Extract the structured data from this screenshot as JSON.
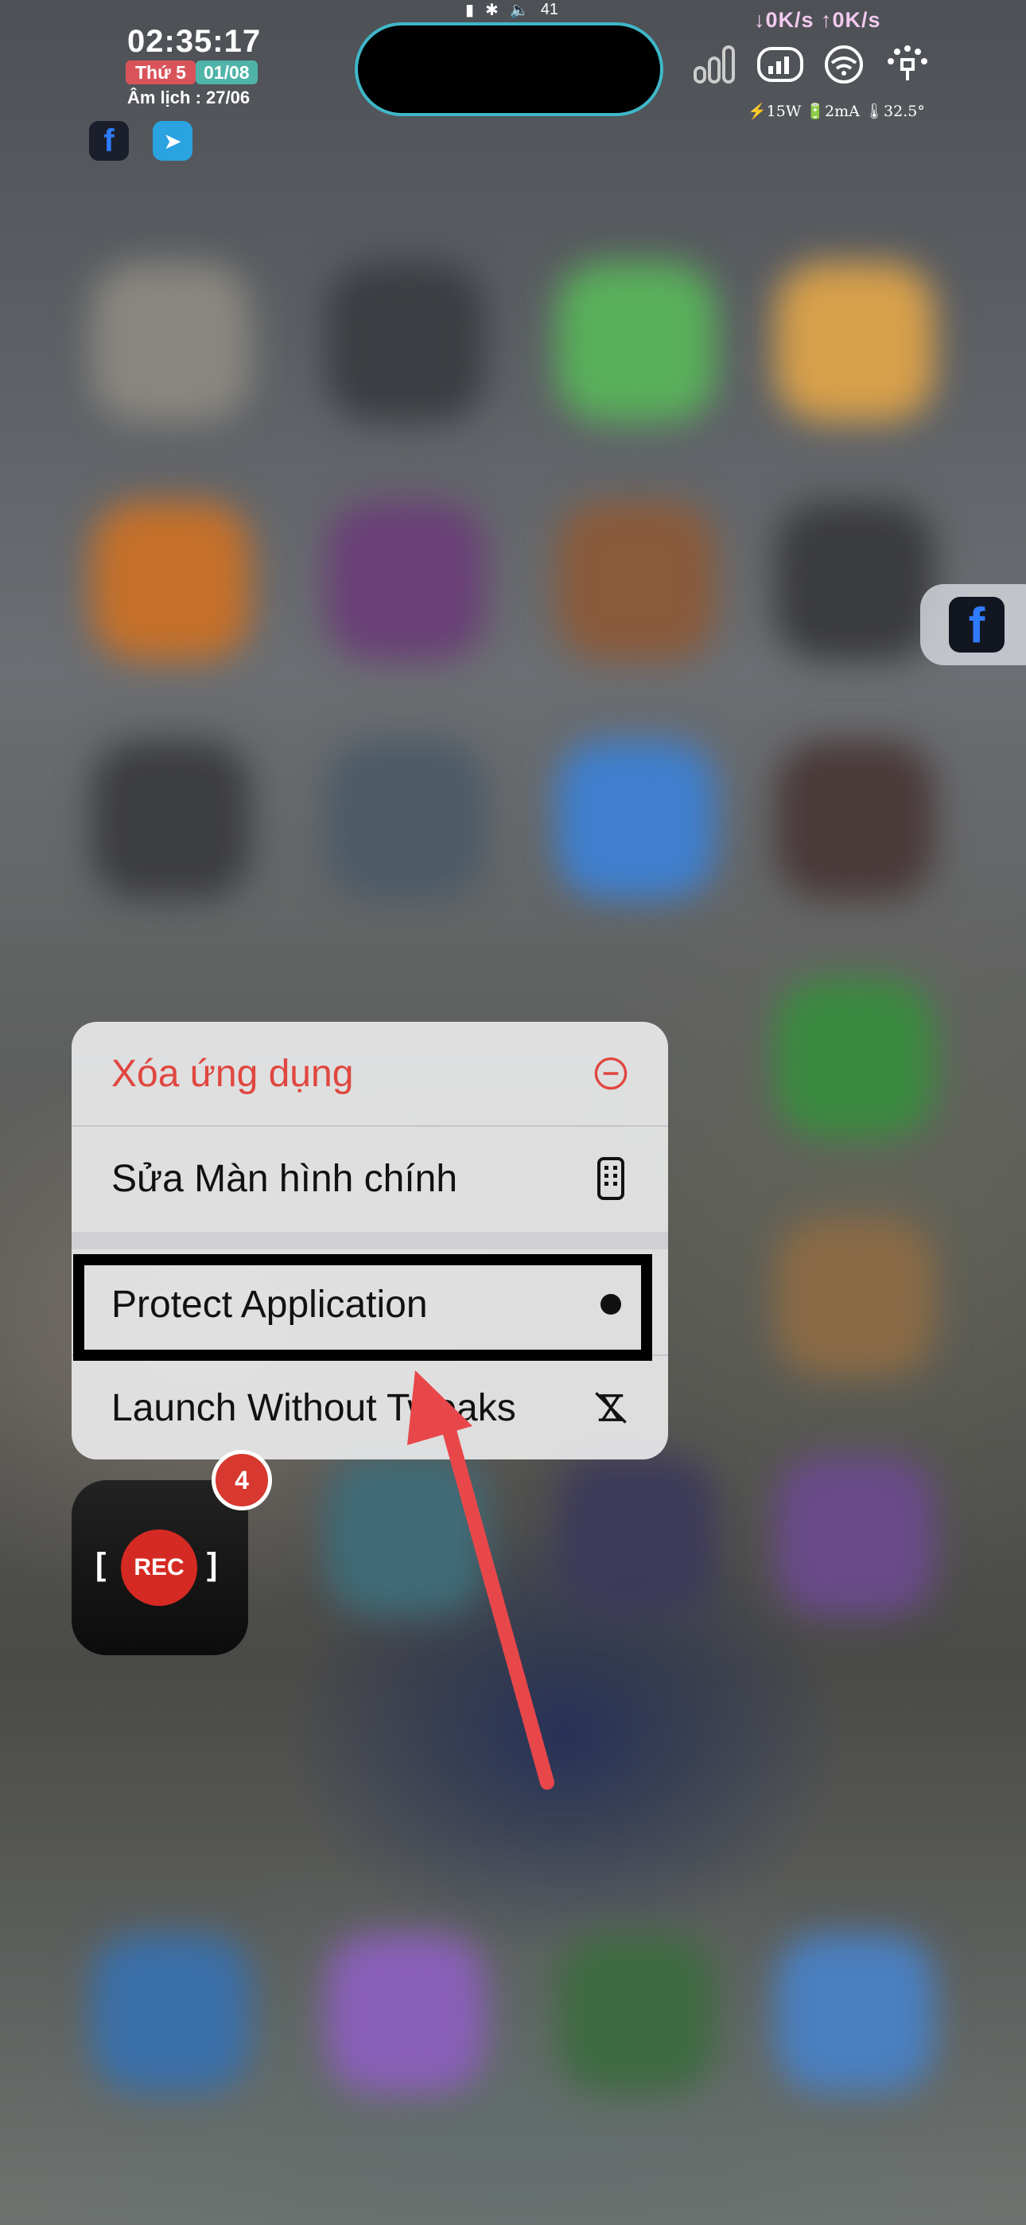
{
  "status_bar": {
    "time": "02:35:17",
    "weekday": "Thứ 5",
    "date": "01/08",
    "lunar": "Âm lịch : 27/06",
    "volume": "41",
    "network_speed": "↓0K/s ↑0K/s",
    "stats": "⚡15W 🔋2mA 🌡32.5°"
  },
  "notification_icons": [
    "facebook-icon",
    "telegram-icon"
  ],
  "context_menu": {
    "items": [
      {
        "label": "Xóa ứng dụng",
        "icon": "minus-circle-icon",
        "color": "#e0473f"
      },
      {
        "label": "Sửa Màn hình chính",
        "icon": "phone-grid-icon"
      },
      {
        "label": "Protect Application",
        "icon": "dot-icon",
        "highlighted": true
      },
      {
        "label": "Launch Without Tweaks",
        "icon": "no-tweaks-icon"
      }
    ]
  },
  "app": {
    "name_label": "REC",
    "badge_count": "4"
  },
  "side_app": "facebook-icon",
  "annotation": {
    "type": "arrow",
    "color": "#e8474a",
    "step": "4"
  }
}
